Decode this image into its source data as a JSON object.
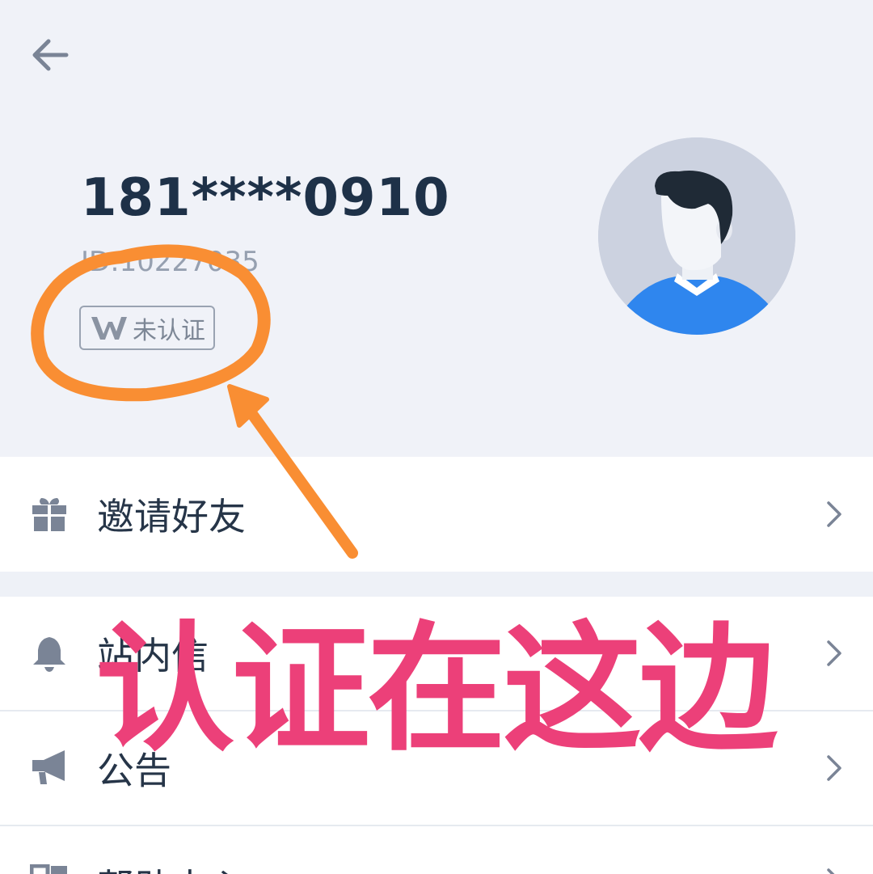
{
  "profile": {
    "phone": "181****0910",
    "user_id": "ID:10227035",
    "verify_status": "未认证"
  },
  "icons": {
    "back": "arrow-left-icon",
    "verify": "v-shield-icon",
    "invite": "gift-icon",
    "messages": "bell-icon",
    "announcements": "megaphone-icon",
    "help": "grid-icon",
    "chevron": "chevron-right-icon"
  },
  "menu": {
    "invite_label": "邀请好友",
    "messages_label": "站内信",
    "announcements_label": "公告",
    "help_label": "帮助中心"
  },
  "annotation": {
    "text": "认证在这边",
    "circle_color": "#f98e33",
    "arrow_color": "#f98e33",
    "text_color": "#ec4079"
  },
  "colors": {
    "header_bg": "#f0f2f8",
    "page_bg": "#eef1f7",
    "primary_text": "#1e3148",
    "secondary_text": "#96a0b0",
    "avatar_shirt": "#2f86ee",
    "avatar_bg": "#ccd2e0"
  }
}
